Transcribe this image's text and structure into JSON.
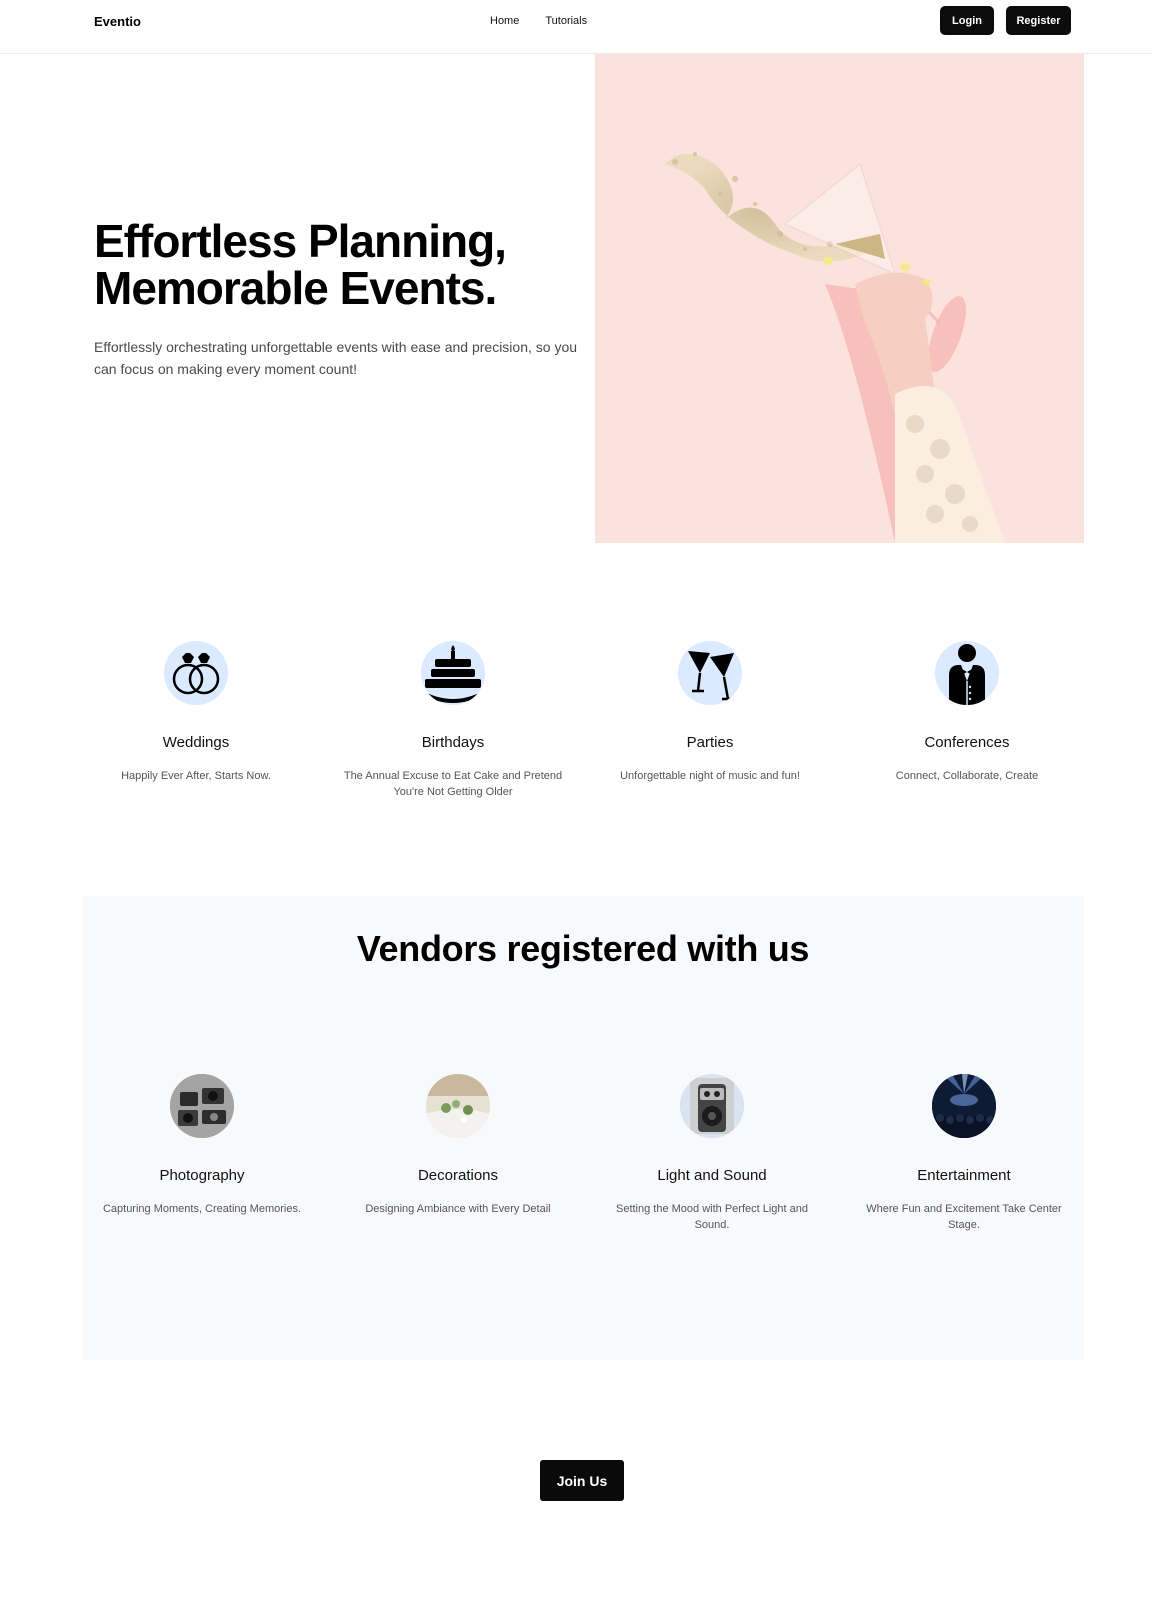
{
  "header": {
    "brand": "Eventio",
    "nav": [
      {
        "label": "Home"
      },
      {
        "label": "Tutorials"
      }
    ],
    "login_label": "Login",
    "register_label": "Register"
  },
  "hero": {
    "title_line1": "Effortless Planning,",
    "title_line2": "Memorable Events.",
    "subtitle": "Effortlessly orchestrating unforgettable events with ease and precision, so you can focus on making every moment count!",
    "image_icon": "champagne-glass-glitter-image"
  },
  "categories": [
    {
      "icon": "wedding-rings-icon",
      "title": "Weddings",
      "desc": "Happily Ever After, Starts Now."
    },
    {
      "icon": "birthday-cake-icon",
      "title": "Birthdays",
      "desc": "The Annual Excuse to Eat Cake and Pretend You're Not Getting Older"
    },
    {
      "icon": "cocktail-glasses-icon",
      "title": "Parties",
      "desc": "Unforgettable night of music and fun!"
    },
    {
      "icon": "businessman-icon",
      "title": "Conferences",
      "desc": "Connect, Collaborate, Create"
    }
  ],
  "vendors": {
    "title": "Vendors registered with us",
    "items": [
      {
        "icon": "camera-gear-photo",
        "title": "Photography",
        "desc": "Capturing Moments, Creating Memories."
      },
      {
        "icon": "table-decor-photo",
        "title": "Decorations",
        "desc": "Designing Ambiance with Every Detail"
      },
      {
        "icon": "speaker-photo",
        "title": "Light and Sound",
        "desc": "Setting the Mood with Perfect Light and Sound."
      },
      {
        "icon": "concert-stage-photo",
        "title": "Entertainment",
        "desc": "Where Fun and Excitement Take Center Stage."
      }
    ]
  },
  "cta": {
    "join_label": "Join Us"
  },
  "colors": {
    "accent": "#0c0c0c",
    "hero_bg": "#fbe2dd",
    "icon_circle": "#dbeafe",
    "vendors_bg": "#f8f9fb"
  }
}
